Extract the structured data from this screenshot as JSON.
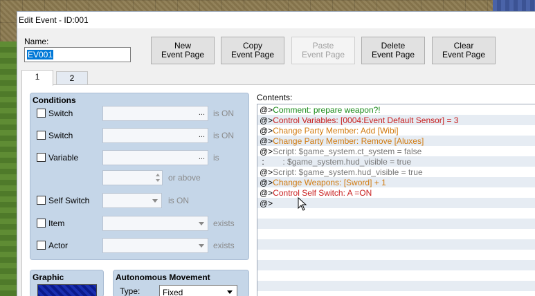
{
  "window": {
    "title": "Edit Event - ID:001"
  },
  "name": {
    "label": "Name:",
    "value": "EV001"
  },
  "toolbar": {
    "new": "New\nEvent Page",
    "copy": "Copy\nEvent Page",
    "paste": "Paste\nEvent Page",
    "delete": "Delete\nEvent Page",
    "clear": "Clear\nEvent Page"
  },
  "tabs": [
    "1",
    "2"
  ],
  "conditions": {
    "title": "Conditions",
    "switch1": {
      "label": "Switch",
      "suffix": "is ON",
      "dots": "..."
    },
    "switch2": {
      "label": "Switch",
      "suffix": "is ON",
      "dots": "..."
    },
    "variable": {
      "label": "Variable",
      "suffix": "is",
      "dots": "...",
      "above": "or above"
    },
    "self_switch": {
      "label": "Self Switch",
      "suffix": "is ON"
    },
    "item": {
      "label": "Item",
      "suffix": "exists"
    },
    "actor": {
      "label": "Actor",
      "suffix": "exists"
    }
  },
  "graphic": {
    "title": "Graphic"
  },
  "autonomous": {
    "title": "Autonomous Movement",
    "type_label": "Type:",
    "type_value": "Fixed"
  },
  "contents": {
    "label": "Contents:",
    "lines": [
      {
        "prefix": "@>",
        "text": "Comment: prepare weapon?!",
        "color": "green"
      },
      {
        "prefix": "@>",
        "text": "Control Variables: [0004:Event Default Sensor] = 3",
        "color": "red"
      },
      {
        "prefix": "@>",
        "text": "Change Party Member: Add [Wibi]",
        "color": "orange"
      },
      {
        "prefix": "@>",
        "text": "Change Party Member: Remove [Aluxes]",
        "color": "orange"
      },
      {
        "prefix": "@>",
        "text": "Script: $game_system.ct_system = false",
        "color": "gray"
      },
      {
        "prefix": " : ",
        "text": "       : $game_system.hud_visible = true",
        "color": "gray"
      },
      {
        "prefix": "@>",
        "text": "Script: $game_system.hud_visible = true",
        "color": "gray"
      },
      {
        "prefix": "@>",
        "text": "Change Weapons: [Sword] + 1",
        "color": "orange"
      },
      {
        "prefix": "@>",
        "text": "Control Self Switch: A =ON",
        "color": "red"
      },
      {
        "prefix": "@>",
        "text": "",
        "color": "gray"
      }
    ]
  },
  "colors": {
    "green": "#188a18",
    "red": "#c81e1e",
    "orange": "#d07a10",
    "gray": "#777777"
  }
}
